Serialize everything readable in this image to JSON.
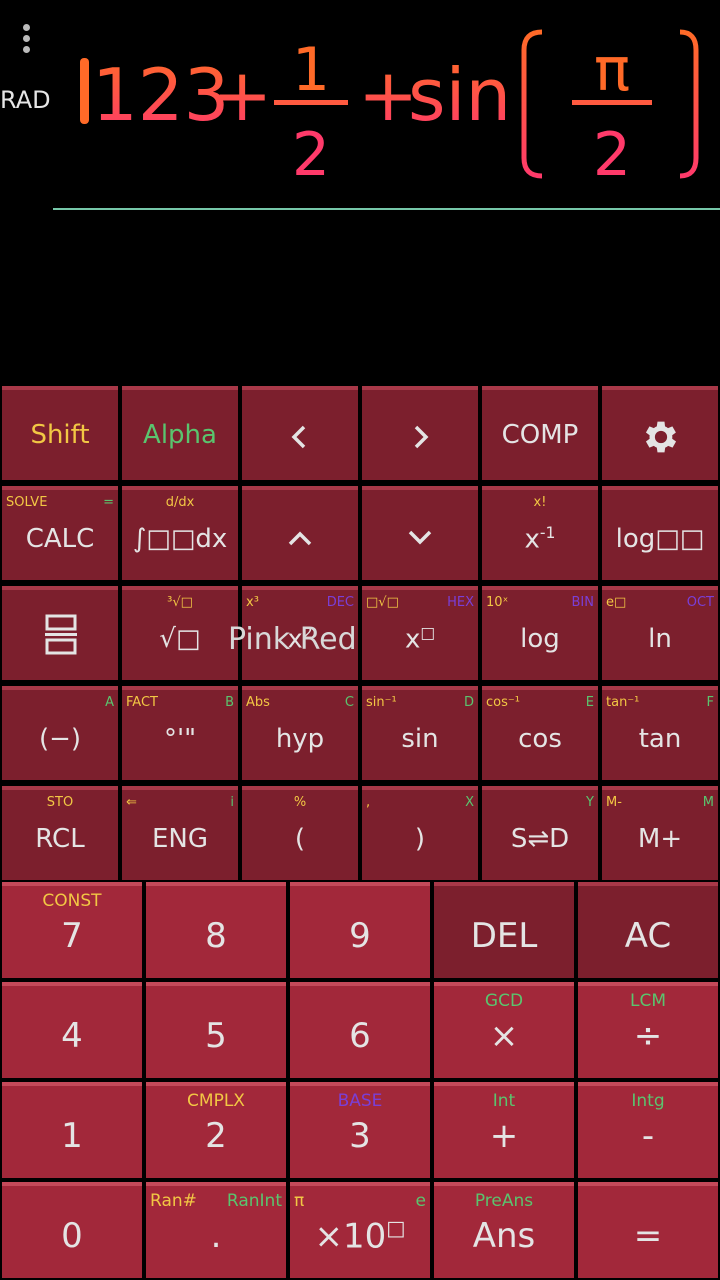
{
  "display": {
    "angle_mode": "RAD",
    "menu_icon": "more-vert-icon",
    "expression": {
      "integer": "123",
      "plus1": "+",
      "frac_num": "1",
      "frac_den": "2",
      "plus2": "+",
      "func": "sin",
      "inner_num": "π",
      "inner_den": "2"
    }
  },
  "theme_label": "Pink Red",
  "colors": {
    "background": "#000000",
    "key_dark": "#7c1f2d",
    "key_light": "#a2283a",
    "shift_yellow": "#f2c744",
    "alpha_green": "#5ac46e",
    "base_purple": "#7a3fd6",
    "expr_orange": "#ff6a28",
    "expr_pink": "#ff3a6a",
    "result_line": "#76c7a9"
  },
  "row1": {
    "shift": "Shift",
    "alpha": "Alpha",
    "left_icon": "chevron-left-icon",
    "right_icon": "chevron-right-icon",
    "comp": "COMP",
    "settings_icon": "gear-icon"
  },
  "row2": {
    "calc": {
      "main": "CALC",
      "shift": "SOLVE",
      "alpha": "="
    },
    "integral": {
      "main": "∫□□dx",
      "shift": "d/dx"
    },
    "up_icon": "chevron-up-icon",
    "down_icon": "chevron-down-icon",
    "inverse": {
      "main": "x",
      "sup": "-1",
      "shift": "x!"
    },
    "log_base": {
      "main": "log□□"
    }
  },
  "row3": {
    "fraction_icon": "fraction-icon",
    "sqrt": {
      "main": "√□",
      "shift": "³√□"
    },
    "square": {
      "main": "x",
      "sup": "2",
      "shift": "x³",
      "base": "DEC"
    },
    "power": {
      "main": "x",
      "sup": "□",
      "shift": "□√□",
      "base": "HEX"
    },
    "log": {
      "main": "log",
      "shift": "10ˣ",
      "base": "BIN"
    },
    "ln": {
      "main": "ln",
      "shift": "e□",
      "base": "OCT"
    }
  },
  "row4": {
    "neg": {
      "main": "(−)",
      "alpha": "A"
    },
    "dms": {
      "main": "°'\"",
      "shift": "FACT",
      "alpha": "B"
    },
    "hyp": {
      "main": "hyp",
      "shift": "Abs",
      "alpha": "C"
    },
    "sin": {
      "main": "sin",
      "shift": "sin⁻¹",
      "alpha": "D"
    },
    "cos": {
      "main": "cos",
      "shift": "cos⁻¹",
      "alpha": "E"
    },
    "tan": {
      "main": "tan",
      "shift": "tan⁻¹",
      "alpha": "F"
    }
  },
  "row5": {
    "rcl": {
      "main": "RCL",
      "shift": "STO"
    },
    "eng": {
      "main": "ENG",
      "shift": "⇐",
      "alpha": "i"
    },
    "lparen": {
      "main": "(",
      "shift": "%"
    },
    "rparen": {
      "main": ")",
      "shift": ",",
      "alpha": "X"
    },
    "sd": {
      "main": "S⇌D",
      "alpha": "Y"
    },
    "mplus": {
      "main": "M+",
      "shift": "M-",
      "alpha": "M"
    }
  },
  "row6": {
    "seven": {
      "main": "7",
      "shift": "CONST"
    },
    "eight": {
      "main": "8"
    },
    "nine": {
      "main": "9"
    },
    "del": {
      "main": "DEL"
    },
    "ac": {
      "main": "AC"
    }
  },
  "row7": {
    "four": {
      "main": "4"
    },
    "five": {
      "main": "5"
    },
    "six": {
      "main": "6"
    },
    "mul": {
      "main": "×",
      "alpha": "GCD"
    },
    "div": {
      "main": "÷",
      "alpha": "LCM"
    }
  },
  "row8": {
    "one": {
      "main": "1"
    },
    "two": {
      "main": "2",
      "shift": "CMPLX"
    },
    "three": {
      "main": "3",
      "base": "BASE"
    },
    "plus": {
      "main": "+",
      "alpha": "Int"
    },
    "minus": {
      "main": "-",
      "alpha": "Intg"
    }
  },
  "row9": {
    "zero": {
      "main": "0"
    },
    "dot": {
      "main": ".",
      "shift": "Ran#",
      "alpha": "RanInt"
    },
    "exp": {
      "main": "×10",
      "sup": "□",
      "shift": "π",
      "alpha": "e"
    },
    "ans": {
      "main": "Ans",
      "alpha": "PreAns"
    },
    "equals": {
      "main": "="
    }
  }
}
